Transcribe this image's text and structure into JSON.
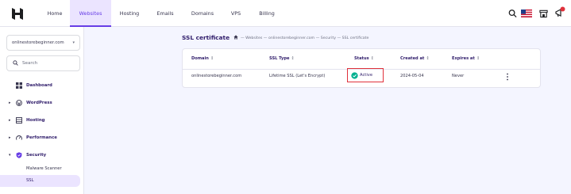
{
  "topnav": {
    "items": [
      {
        "label": "Home",
        "active": false
      },
      {
        "label": "Websites",
        "active": true
      },
      {
        "label": "Hosting",
        "active": false
      },
      {
        "label": "Emails",
        "active": false
      },
      {
        "label": "Domains",
        "active": false
      },
      {
        "label": "VPS",
        "active": false
      },
      {
        "label": "Billing",
        "active": false
      }
    ],
    "icons": [
      "search-icon",
      "us-flag-icon",
      "store-icon",
      "megaphone-icon"
    ],
    "notification_badge": "0"
  },
  "sidebar": {
    "site_selector": "onlinestorebeginner.com",
    "search_placeholder": "Search",
    "items": [
      {
        "label": "Dashboard",
        "icon": "dashboard-icon",
        "expandable": false
      },
      {
        "label": "WordPress",
        "icon": "wordpress-icon",
        "expandable": true
      },
      {
        "label": "Hosting",
        "icon": "hosting-icon",
        "expandable": true
      },
      {
        "label": "Performance",
        "icon": "performance-icon",
        "expandable": true
      },
      {
        "label": "Security",
        "icon": "shield-icon",
        "expandable": true,
        "expanded": true
      }
    ],
    "subitems": [
      {
        "label": "Malware Scanner",
        "active": false
      },
      {
        "label": "SSL",
        "active": true
      }
    ]
  },
  "main": {
    "title": "SSL certificate",
    "breadcrumb": "— Websites — onlinestorebeginner.com — Security — SSL certificate",
    "table": {
      "headers": [
        "Domain",
        "SSL Type",
        "Status",
        "Created at",
        "Expires at"
      ],
      "sort_glyph": "↕",
      "rows": [
        {
          "domain": "onlinestorebeginner.com",
          "ssl_type": "Lifetime SSL (Let's Encrypt)",
          "status": "Active",
          "created_at": "2024-05-04",
          "expires_at": "Never"
        }
      ]
    }
  },
  "colors": {
    "accent": "#673de6",
    "active_bg": "#ebe4ff",
    "status_ok": "#00b090",
    "highlight_box": "#e0313b"
  }
}
